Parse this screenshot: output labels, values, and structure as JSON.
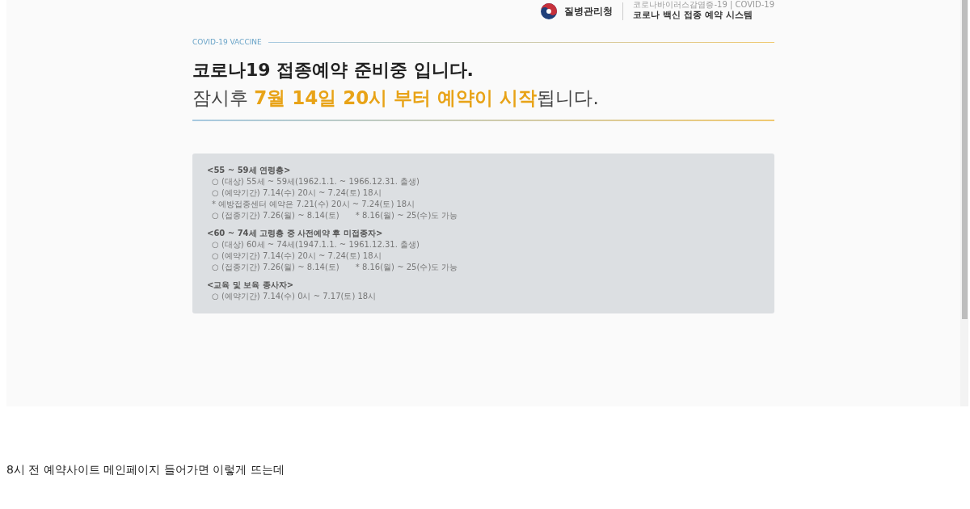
{
  "header": {
    "agency": "질병관리청",
    "subtitle": "코로나바이러스감염증-19 | COVID-19",
    "system": "코로나 백신 접종 예약 시스템"
  },
  "eyebrow": "COVID-19 VACCINE",
  "title": "코로나19 접종예약 준비중 입니다.",
  "subtitle": "잠시후 **7월 14일 20시 부터 예약이 시작**됩니다.",
  "notice_groups": [
    {
      "heading": "<55 ~ 59세 연령층>",
      "lines": [
        {
          "text": "○ (대상) 55세 ~ 59세(1962.1.1. ~ 1966.12.31. 출생)"
        },
        {
          "text": "○ (예약기간) 7.14(수) 20시 ~ 7.24(토) 18시"
        },
        {
          "text": "* 예방접종센터 예약은 7.21(수) 20시 ~ 7.24(토) 18시"
        },
        {
          "text": "○ (접종기간) 7.26(월) ~ 8.14(토)",
          "note": "* 8.16(월) ~ 25(수)도 가능"
        }
      ]
    },
    {
      "heading": "<60 ~ 74세 고령층 중 사전예약 후 미접종자>",
      "lines": [
        {
          "text": "○ (대상) 60세 ~ 74세(1947.1.1. ~ 1961.12.31. 출생)"
        },
        {
          "text": "○ (예약기간) 7.14(수) 20시 ~ 7.24(토) 18시"
        },
        {
          "text": "○ (접종기간) 7.26(월) ~ 8.14(토)",
          "note": "* 8.16(월) ~ 25(수)도 가능"
        }
      ]
    },
    {
      "heading": "<교육 및 보육 종사자>",
      "lines": [
        {
          "text": "○ (예약기간) 7.14(수) 0시 ~ 7.17(토) 18시"
        }
      ]
    }
  ],
  "caption": "8시 전 예약사이트 메인페이지 들어가면 이렇게 뜨는데"
}
